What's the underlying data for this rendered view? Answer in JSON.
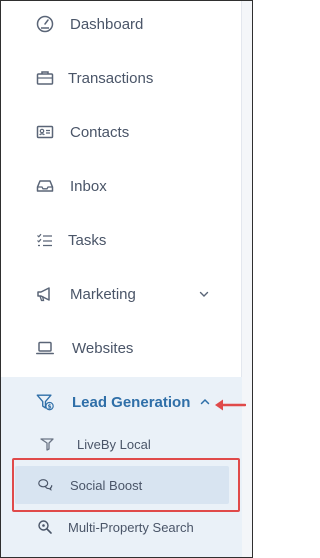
{
  "nav": {
    "items": [
      {
        "label": "Dashboard",
        "icon": "dashboard-gauge-icon"
      },
      {
        "label": "Transactions",
        "icon": "briefcase-icon"
      },
      {
        "label": "Contacts",
        "icon": "contact-card-icon"
      },
      {
        "label": "Inbox",
        "icon": "inbox-tray-icon"
      },
      {
        "label": "Tasks",
        "icon": "checklist-icon"
      },
      {
        "label": "Marketing",
        "icon": "megaphone-icon",
        "expand_icon": "chevron-down-icon"
      },
      {
        "label": "Websites",
        "icon": "laptop-icon"
      }
    ],
    "active_section": {
      "label": "Lead Generation",
      "icon": "funnel-dollar-icon",
      "expand_icon": "chevron-up-icon",
      "subitems": [
        {
          "label": "LiveBy Local",
          "icon": "liveby-logo-icon"
        },
        {
          "label": "Social Boost",
          "icon": "chat-bubbles-icon",
          "selected": true
        },
        {
          "label": "Multi-Property Search",
          "icon": "search-magnifier-icon"
        }
      ]
    }
  },
  "colors": {
    "text": "#4a5568",
    "active_text": "#2f6fa8",
    "section_bg": "#eaf1f8",
    "selected_bg": "#d8e4f1",
    "annotation_red": "#e04a4a"
  }
}
